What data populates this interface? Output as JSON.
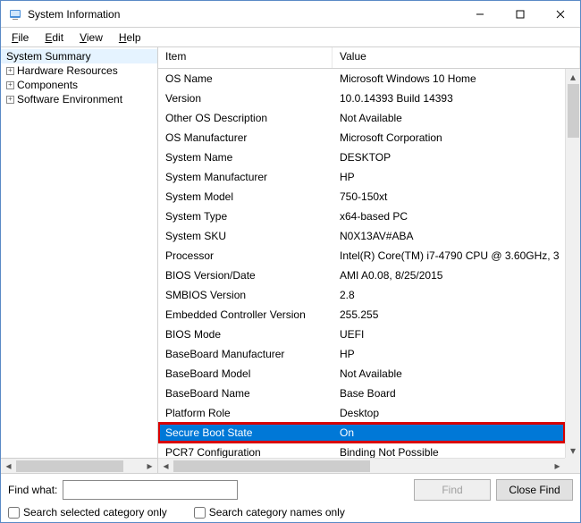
{
  "window": {
    "title": "System Information"
  },
  "menubar": {
    "file": "File",
    "edit": "Edit",
    "view": "View",
    "help": "Help"
  },
  "tree": {
    "root": "System Summary",
    "items": [
      "Hardware Resources",
      "Components",
      "Software Environment"
    ]
  },
  "columns": {
    "item": "Item",
    "value": "Value"
  },
  "rows": [
    {
      "item": "OS Name",
      "value": "Microsoft Windows 10 Home"
    },
    {
      "item": "Version",
      "value": "10.0.14393 Build 14393"
    },
    {
      "item": "Other OS Description",
      "value": "Not Available"
    },
    {
      "item": "OS Manufacturer",
      "value": "Microsoft Corporation"
    },
    {
      "item": "System Name",
      "value": "DESKTOP"
    },
    {
      "item": "System Manufacturer",
      "value": "HP"
    },
    {
      "item": "System Model",
      "value": "750-150xt"
    },
    {
      "item": "System Type",
      "value": "x64-based PC"
    },
    {
      "item": "System SKU",
      "value": "N0X13AV#ABA"
    },
    {
      "item": "Processor",
      "value": "Intel(R) Core(TM) i7-4790 CPU @ 3.60GHz, 3"
    },
    {
      "item": "BIOS Version/Date",
      "value": "AMI A0.08, 8/25/2015"
    },
    {
      "item": "SMBIOS Version",
      "value": "2.8"
    },
    {
      "item": "Embedded Controller Version",
      "value": "255.255"
    },
    {
      "item": "BIOS Mode",
      "value": "UEFI"
    },
    {
      "item": "BaseBoard Manufacturer",
      "value": "HP"
    },
    {
      "item": "BaseBoard Model",
      "value": "Not Available"
    },
    {
      "item": "BaseBoard Name",
      "value": "Base Board"
    },
    {
      "item": "Platform Role",
      "value": "Desktop"
    },
    {
      "item": "Secure Boot State",
      "value": "On",
      "selected": true
    },
    {
      "item": "PCR7 Configuration",
      "value": "Binding Not Possible"
    }
  ],
  "footer": {
    "find_label": "Find what:",
    "find_value": "",
    "find_button": "Find",
    "close_find_button": "Close Find",
    "chk_selected": "Search selected category only",
    "chk_names": "Search category names only"
  }
}
